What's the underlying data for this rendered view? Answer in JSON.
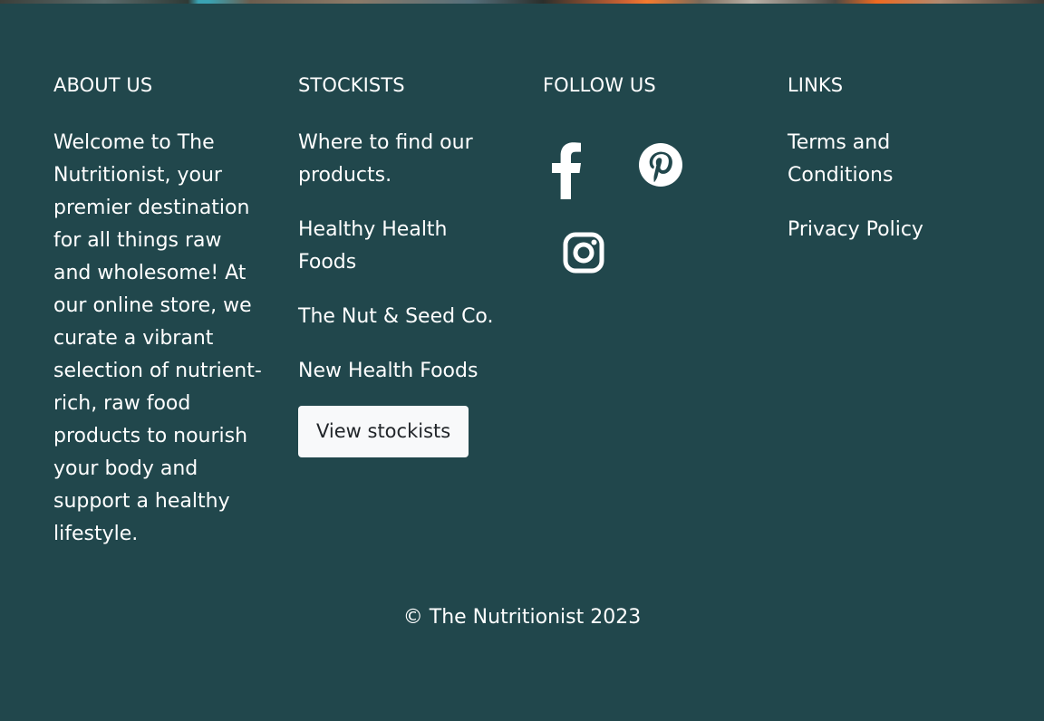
{
  "about": {
    "heading": "ABOUT US",
    "text": "Welcome to The Nutritionist, your premier destination for all things raw and wholesome! At our online store, we curate a vibrant selection of nutrient-rich, raw food products to nourish your body and support a healthy lifestyle."
  },
  "stockists": {
    "heading": "STOCKISTS",
    "items": [
      {
        "label": "Where to find our products."
      },
      {
        "label": "Healthy Health Foods"
      },
      {
        "label": "The Nut & Seed Co."
      },
      {
        "label": "New Health Foods"
      }
    ],
    "button_label": "View stockists"
  },
  "follow": {
    "heading": "FOLLOW US",
    "icons": [
      "facebook-icon",
      "pinterest-icon",
      "instagram-icon"
    ]
  },
  "links": {
    "heading": "LINKS",
    "items": [
      {
        "label": "Terms and Conditions"
      },
      {
        "label": "Privacy Policy"
      }
    ]
  },
  "copyright": "© The Nutritionist 2023",
  "colors": {
    "background": "#21474c",
    "text": "#ffffff",
    "button_bg": "#f8f9fa",
    "button_text": "#212529"
  }
}
